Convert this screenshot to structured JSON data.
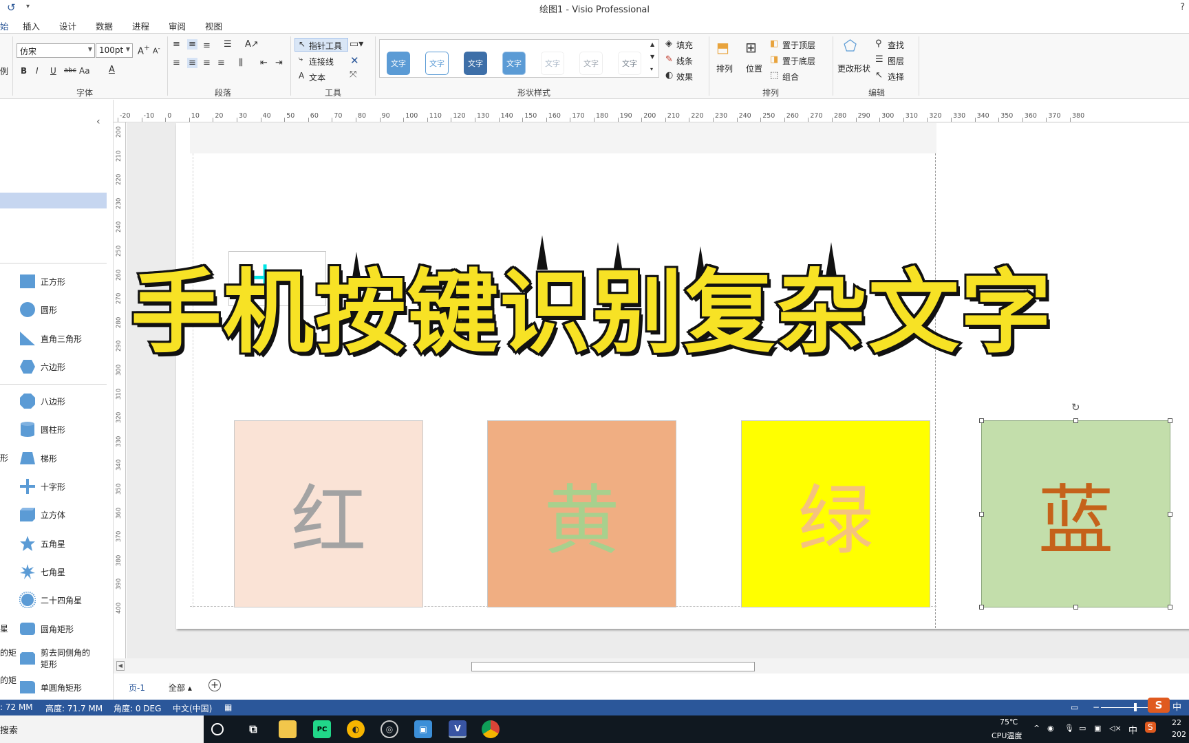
{
  "window": {
    "title": "绘图1 - Visio Professional",
    "help": "?"
  },
  "tabs": [
    "始",
    "插入",
    "设计",
    "数据",
    "进程",
    "审阅",
    "视图"
  ],
  "ribbon": {
    "font": {
      "name": "仿宋",
      "size": "100pt",
      "group_label": "字体",
      "bold": "B",
      "italic": "I",
      "underline": "U",
      "strike": "abc",
      "case": "Aa"
    },
    "paragraph": {
      "group_label": "段落"
    },
    "tools": {
      "pointer": "指针工具",
      "connector": "连接线",
      "text": "文本",
      "group_label": "工具"
    },
    "shape_styles": {
      "swatches": [
        "文字",
        "文字",
        "文字",
        "文字",
        "文字",
        "文字",
        "文字"
      ],
      "group_label": "形状样式",
      "fill": "填充",
      "line": "线条",
      "effect": "效果"
    },
    "arrange": {
      "arrange": "排列",
      "position": "位置",
      "bring_front": "置于顶层",
      "send_back": "置于底层",
      "group": "组合",
      "group_label": "排列"
    },
    "editing": {
      "change_shape": "更改形状",
      "find": "查找",
      "layers": "图层",
      "select": "选择",
      "group_label": "编辑"
    },
    "left_cut": "例"
  },
  "shapes_pane": {
    "items": [
      {
        "label": "正方形",
        "icon": "square-icon"
      },
      {
        "label": "圆形",
        "icon": "circle-icon"
      },
      {
        "label": "直角三角形",
        "icon": "right-triangle-icon"
      },
      {
        "label": "六边形",
        "icon": "hexagon-icon"
      },
      {
        "label": "八边形",
        "icon": "octagon-icon"
      },
      {
        "label": "圆柱形",
        "icon": "cylinder-icon"
      },
      {
        "label": "梯形",
        "icon": "trapezoid-icon"
      },
      {
        "label": "十字形",
        "icon": "cross-icon"
      },
      {
        "label": "立方体",
        "icon": "cube-icon"
      },
      {
        "label": "五角星",
        "icon": "five-star-icon"
      },
      {
        "label": "七角星",
        "icon": "seven-star-icon"
      },
      {
        "label": "二十四角星",
        "icon": "24-star-icon"
      },
      {
        "label": "圆角矩形",
        "icon": "rounded-rect-icon"
      },
      {
        "label": "剪去同侧角的矩形",
        "icon": "snip-rect-icon"
      },
      {
        "label": "单圆角矩形",
        "icon": "single-round-rect-icon"
      }
    ],
    "left_cut_labels": [
      "形",
      "星",
      "的矩",
      "的矩"
    ]
  },
  "ruler": {
    "h_ticks": [
      "-20",
      "-10",
      "0",
      "10",
      "20",
      "30",
      "40",
      "50",
      "60",
      "70",
      "80",
      "90",
      "100",
      "110",
      "120",
      "130",
      "140",
      "150",
      "160",
      "170",
      "180",
      "190",
      "200",
      "210",
      "220",
      "230",
      "240",
      "250",
      "260",
      "270",
      "280",
      "290",
      "300",
      "310",
      "320",
      "330",
      "340",
      "350",
      "360",
      "370",
      "380"
    ],
    "v_ticks": [
      "200",
      "210",
      "220",
      "230",
      "240",
      "250",
      "260",
      "270",
      "280",
      "290",
      "300",
      "310",
      "320",
      "330",
      "340",
      "350",
      "360",
      "370",
      "380",
      "390",
      "400"
    ]
  },
  "canvas": {
    "squares": [
      {
        "char": "红",
        "bg": "#fae3d6",
        "fg": "#a3a3a3"
      },
      {
        "char": "黄",
        "bg": "#f0ae82",
        "fg": "#a8d08d"
      },
      {
        "char": "绿",
        "bg": "#ffff00",
        "fg": "#f5c27f"
      },
      {
        "char": "蓝",
        "bg": "#c3deab",
        "fg": "#c5621a"
      }
    ],
    "cross_char": "十"
  },
  "overlay_title": "手机按键识别复杂文字",
  "page_tabs": {
    "page": "页-1",
    "all": "全部",
    "add": "+"
  },
  "status": {
    "width": ": 72 MM",
    "height": "高度: 71.7 MM",
    "angle": "角度: 0 DEG",
    "lang": "中文(中国)"
  },
  "taskbar": {
    "search": "搜索",
    "temp": "75℃",
    "temp_label": "CPU温度",
    "ime": "中",
    "ime2": "中",
    "time": "22",
    "date": "202"
  },
  "colors": {
    "accent": "#2b579a",
    "overlay_fill": "#f7e225"
  }
}
